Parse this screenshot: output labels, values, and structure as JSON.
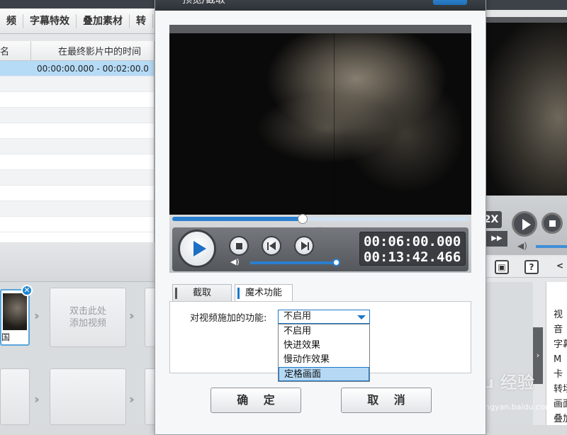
{
  "background": {
    "top_tabs": [
      "频",
      "字幕特效",
      "叠加素材",
      "转"
    ],
    "list": {
      "headers": [
        "名",
        "在最终影片中的时间"
      ],
      "selected_row_time": "00:00:00.000 - 00:02:00.0"
    },
    "clip_caption": "国",
    "add_video_hint": "双击此处\n添加视频",
    "right_panel_labels": [
      "视",
      "音",
      "字幕",
      "M",
      "卡",
      "转场",
      "画面",
      "叠加"
    ],
    "speed_badge": "2X",
    "watermark": "Bai du 经验",
    "watermark_sub": "jingyan.baidu.com"
  },
  "dialog": {
    "title": "预览/截取",
    "player": {
      "seek_progress": 0.44,
      "volume_level": 0.98,
      "current_time": "00:06:00.000",
      "total_time": "00:13:42.466"
    },
    "tabs": [
      {
        "label": "截取",
        "active": false
      },
      {
        "label": "魔术功能",
        "active": true
      }
    ],
    "magic": {
      "field_label": "对视频施加的功能:",
      "selected": "不启用",
      "options": [
        "不启用",
        "快进效果",
        "慢动作效果",
        "定格画面"
      ],
      "highlighted_index": 3
    },
    "ok_label": "确 定",
    "cancel_label": "取 消"
  }
}
